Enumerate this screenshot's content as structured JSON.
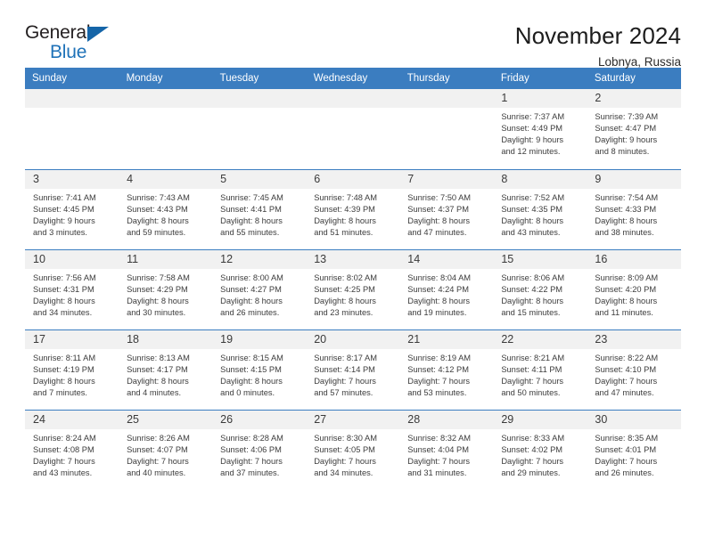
{
  "brand": {
    "word1": "General",
    "word2": "Blue",
    "triangle_color": "#1565a8",
    "blue_text_color": "#1f72b8"
  },
  "header": {
    "title": "November 2024",
    "subtitle": "Lobnya, Russia"
  },
  "theme": {
    "header_blue": "#3b7dc0",
    "daynum_band": "#f1f1f1",
    "text": "#3c3c3c"
  },
  "weekday_headers": [
    "Sunday",
    "Monday",
    "Tuesday",
    "Wednesday",
    "Thursday",
    "Friday",
    "Saturday"
  ],
  "labels": {
    "sunrise": "Sunrise:",
    "sunset": "Sunset:",
    "daylight": "Daylight:"
  },
  "weeks": [
    [
      {
        "day": "",
        "blank": true
      },
      {
        "day": "",
        "blank": true
      },
      {
        "day": "",
        "blank": true
      },
      {
        "day": "",
        "blank": true
      },
      {
        "day": "",
        "blank": true
      },
      {
        "day": "1",
        "sunrise": "Sunrise: 7:37 AM",
        "sunset": "Sunset: 4:49 PM",
        "daylight1": "Daylight: 9 hours",
        "daylight2": "and 12 minutes."
      },
      {
        "day": "2",
        "sunrise": "Sunrise: 7:39 AM",
        "sunset": "Sunset: 4:47 PM",
        "daylight1": "Daylight: 9 hours",
        "daylight2": "and 8 minutes."
      }
    ],
    [
      {
        "day": "3",
        "sunrise": "Sunrise: 7:41 AM",
        "sunset": "Sunset: 4:45 PM",
        "daylight1": "Daylight: 9 hours",
        "daylight2": "and 3 minutes."
      },
      {
        "day": "4",
        "sunrise": "Sunrise: 7:43 AM",
        "sunset": "Sunset: 4:43 PM",
        "daylight1": "Daylight: 8 hours",
        "daylight2": "and 59 minutes."
      },
      {
        "day": "5",
        "sunrise": "Sunrise: 7:45 AM",
        "sunset": "Sunset: 4:41 PM",
        "daylight1": "Daylight: 8 hours",
        "daylight2": "and 55 minutes."
      },
      {
        "day": "6",
        "sunrise": "Sunrise: 7:48 AM",
        "sunset": "Sunset: 4:39 PM",
        "daylight1": "Daylight: 8 hours",
        "daylight2": "and 51 minutes."
      },
      {
        "day": "7",
        "sunrise": "Sunrise: 7:50 AM",
        "sunset": "Sunset: 4:37 PM",
        "daylight1": "Daylight: 8 hours",
        "daylight2": "and 47 minutes."
      },
      {
        "day": "8",
        "sunrise": "Sunrise: 7:52 AM",
        "sunset": "Sunset: 4:35 PM",
        "daylight1": "Daylight: 8 hours",
        "daylight2": "and 43 minutes."
      },
      {
        "day": "9",
        "sunrise": "Sunrise: 7:54 AM",
        "sunset": "Sunset: 4:33 PM",
        "daylight1": "Daylight: 8 hours",
        "daylight2": "and 38 minutes."
      }
    ],
    [
      {
        "day": "10",
        "sunrise": "Sunrise: 7:56 AM",
        "sunset": "Sunset: 4:31 PM",
        "daylight1": "Daylight: 8 hours",
        "daylight2": "and 34 minutes."
      },
      {
        "day": "11",
        "sunrise": "Sunrise: 7:58 AM",
        "sunset": "Sunset: 4:29 PM",
        "daylight1": "Daylight: 8 hours",
        "daylight2": "and 30 minutes."
      },
      {
        "day": "12",
        "sunrise": "Sunrise: 8:00 AM",
        "sunset": "Sunset: 4:27 PM",
        "daylight1": "Daylight: 8 hours",
        "daylight2": "and 26 minutes."
      },
      {
        "day": "13",
        "sunrise": "Sunrise: 8:02 AM",
        "sunset": "Sunset: 4:25 PM",
        "daylight1": "Daylight: 8 hours",
        "daylight2": "and 23 minutes."
      },
      {
        "day": "14",
        "sunrise": "Sunrise: 8:04 AM",
        "sunset": "Sunset: 4:24 PM",
        "daylight1": "Daylight: 8 hours",
        "daylight2": "and 19 minutes."
      },
      {
        "day": "15",
        "sunrise": "Sunrise: 8:06 AM",
        "sunset": "Sunset: 4:22 PM",
        "daylight1": "Daylight: 8 hours",
        "daylight2": "and 15 minutes."
      },
      {
        "day": "16",
        "sunrise": "Sunrise: 8:09 AM",
        "sunset": "Sunset: 4:20 PM",
        "daylight1": "Daylight: 8 hours",
        "daylight2": "and 11 minutes."
      }
    ],
    [
      {
        "day": "17",
        "sunrise": "Sunrise: 8:11 AM",
        "sunset": "Sunset: 4:19 PM",
        "daylight1": "Daylight: 8 hours",
        "daylight2": "and 7 minutes."
      },
      {
        "day": "18",
        "sunrise": "Sunrise: 8:13 AM",
        "sunset": "Sunset: 4:17 PM",
        "daylight1": "Daylight: 8 hours",
        "daylight2": "and 4 minutes."
      },
      {
        "day": "19",
        "sunrise": "Sunrise: 8:15 AM",
        "sunset": "Sunset: 4:15 PM",
        "daylight1": "Daylight: 8 hours",
        "daylight2": "and 0 minutes."
      },
      {
        "day": "20",
        "sunrise": "Sunrise: 8:17 AM",
        "sunset": "Sunset: 4:14 PM",
        "daylight1": "Daylight: 7 hours",
        "daylight2": "and 57 minutes."
      },
      {
        "day": "21",
        "sunrise": "Sunrise: 8:19 AM",
        "sunset": "Sunset: 4:12 PM",
        "daylight1": "Daylight: 7 hours",
        "daylight2": "and 53 minutes."
      },
      {
        "day": "22",
        "sunrise": "Sunrise: 8:21 AM",
        "sunset": "Sunset: 4:11 PM",
        "daylight1": "Daylight: 7 hours",
        "daylight2": "and 50 minutes."
      },
      {
        "day": "23",
        "sunrise": "Sunrise: 8:22 AM",
        "sunset": "Sunset: 4:10 PM",
        "daylight1": "Daylight: 7 hours",
        "daylight2": "and 47 minutes."
      }
    ],
    [
      {
        "day": "24",
        "sunrise": "Sunrise: 8:24 AM",
        "sunset": "Sunset: 4:08 PM",
        "daylight1": "Daylight: 7 hours",
        "daylight2": "and 43 minutes."
      },
      {
        "day": "25",
        "sunrise": "Sunrise: 8:26 AM",
        "sunset": "Sunset: 4:07 PM",
        "daylight1": "Daylight: 7 hours",
        "daylight2": "and 40 minutes."
      },
      {
        "day": "26",
        "sunrise": "Sunrise: 8:28 AM",
        "sunset": "Sunset: 4:06 PM",
        "daylight1": "Daylight: 7 hours",
        "daylight2": "and 37 minutes."
      },
      {
        "day": "27",
        "sunrise": "Sunrise: 8:30 AM",
        "sunset": "Sunset: 4:05 PM",
        "daylight1": "Daylight: 7 hours",
        "daylight2": "and 34 minutes."
      },
      {
        "day": "28",
        "sunrise": "Sunrise: 8:32 AM",
        "sunset": "Sunset: 4:04 PM",
        "daylight1": "Daylight: 7 hours",
        "daylight2": "and 31 minutes."
      },
      {
        "day": "29",
        "sunrise": "Sunrise: 8:33 AM",
        "sunset": "Sunset: 4:02 PM",
        "daylight1": "Daylight: 7 hours",
        "daylight2": "and 29 minutes."
      },
      {
        "day": "30",
        "sunrise": "Sunrise: 8:35 AM",
        "sunset": "Sunset: 4:01 PM",
        "daylight1": "Daylight: 7 hours",
        "daylight2": "and 26 minutes."
      }
    ]
  ]
}
